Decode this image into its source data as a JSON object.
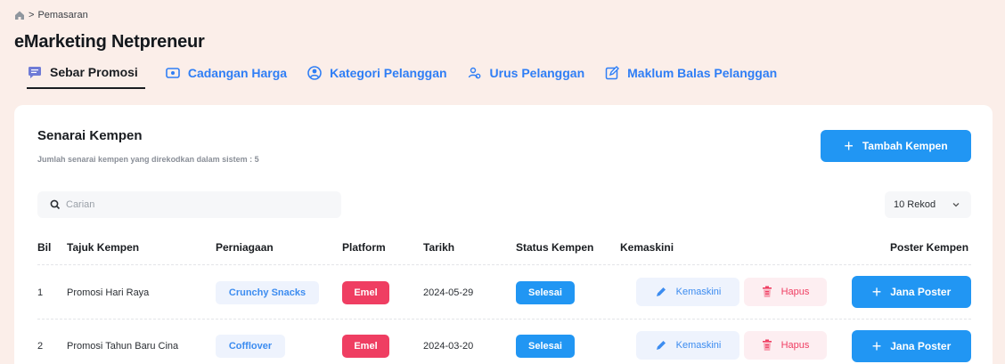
{
  "breadcrumb": {
    "home_icon": "home-icon",
    "separator": ">",
    "current": "Pemasaran"
  },
  "page_title": "eMarketing Netpreneur",
  "tabs": [
    {
      "label": "Sebar Promosi",
      "icon": "message-icon",
      "active": true
    },
    {
      "label": "Cadangan Harga",
      "icon": "money-icon",
      "active": false
    },
    {
      "label": "Kategori Pelanggan",
      "icon": "user-circle-icon",
      "active": false
    },
    {
      "label": "Urus Pelanggan",
      "icon": "users-icon",
      "active": false
    },
    {
      "label": "Maklum Balas Pelanggan",
      "icon": "edit-icon",
      "active": false
    }
  ],
  "card": {
    "title": "Senarai Kempen",
    "subtitle": "Jumlah senarai kempen yang direkodkan dalam sistem : 5",
    "add_button": "Tambah Kempen"
  },
  "search": {
    "placeholder": "Carian",
    "value": ""
  },
  "rows_select": {
    "selected": "10 Rekod"
  },
  "table": {
    "headers": [
      "Bil",
      "Tajuk Kempen",
      "Perniagaan",
      "Platform",
      "Tarikh",
      "Status Kempen",
      "Kemaskini",
      "Poster Kempen"
    ],
    "edit_label": "Kemaskini",
    "delete_label": "Hapus",
    "poster_label": "Jana Poster",
    "rows": [
      {
        "bil": "1",
        "tajuk": "Promosi Hari Raya",
        "perniagaan": "Crunchy Snacks",
        "platform": "Emel",
        "tarikh": "2024-05-29",
        "status": "Selesai"
      },
      {
        "bil": "2",
        "tajuk": "Promosi Tahun Baru Cina",
        "perniagaan": "Cofflover",
        "platform": "Emel",
        "tarikh": "2024-03-20",
        "status": "Selesai"
      }
    ]
  },
  "colors": {
    "primary": "#2196f3",
    "danger": "#ef3e62",
    "page_bg": "#fbeee9",
    "chip_bg": "#eef3fd"
  }
}
